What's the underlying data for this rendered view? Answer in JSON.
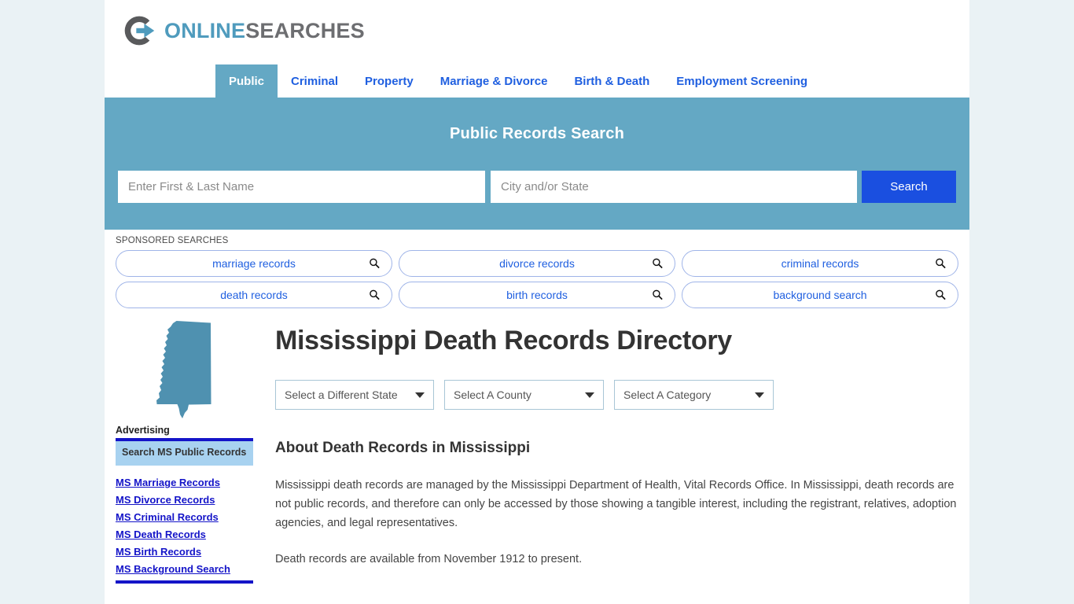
{
  "brand": {
    "name_part1": "ONLINE",
    "name_part2": "SEARCHES",
    "logo_icon": "circle-arrow-logo-icon",
    "accent_blue": "#4f9bbd",
    "accent_gray": "#6d6e71"
  },
  "nav": {
    "tabs": [
      {
        "label": "Public",
        "active": true
      },
      {
        "label": "Criminal",
        "active": false
      },
      {
        "label": "Property",
        "active": false
      },
      {
        "label": "Marriage & Divorce",
        "active": false
      },
      {
        "label": "Birth & Death",
        "active": false
      },
      {
        "label": "Employment Screening",
        "active": false
      }
    ]
  },
  "banner": {
    "title": "Public Records Search",
    "background_color": "#64a8c4",
    "name_input": {
      "value": "",
      "placeholder": "Enter First & Last Name"
    },
    "city_input": {
      "value": "",
      "placeholder": "City and/or State"
    },
    "search_button": {
      "label": "Search",
      "color": "#1a4fe0"
    }
  },
  "sponsored": {
    "label": "SPONSORED SEARCHES",
    "chips": [
      {
        "label": "marriage records",
        "icon": "search-icon"
      },
      {
        "label": "divorce records",
        "icon": "search-icon"
      },
      {
        "label": "criminal records",
        "icon": "search-icon"
      },
      {
        "label": "death records",
        "icon": "search-icon"
      },
      {
        "label": "birth records",
        "icon": "search-icon"
      },
      {
        "label": "background search",
        "icon": "search-icon"
      }
    ]
  },
  "sidebar": {
    "state_map_icon": "mississippi-state-map-icon",
    "advertising_label": "Advertising",
    "ad_box_title": "Search MS Public Records",
    "links": [
      "MS Marriage Records",
      "MS Divorce Records",
      "MS Criminal Records",
      "MS Death Records",
      "MS Birth Records",
      "MS Background Search"
    ]
  },
  "main": {
    "page_title": "Mississippi Death Records Directory",
    "selects": [
      {
        "value": "Select a Different State",
        "icon": "chevron-down-icon"
      },
      {
        "value": "Select A County",
        "icon": "chevron-down-icon"
      },
      {
        "value": "Select A Category",
        "icon": "chevron-down-icon"
      }
    ],
    "section_title": "About Death Records in Mississippi",
    "paragraph_1": "Mississippi death records are managed by the Mississippi Department of Health, Vital Records Office. In Mississippi, death records are not public records, and therefore can only be accessed by those showing a tangible interest, including the registrant, relatives, adoption agencies, and legal representatives.",
    "paragraph_2": "Death records are available from November 1912 to present."
  }
}
